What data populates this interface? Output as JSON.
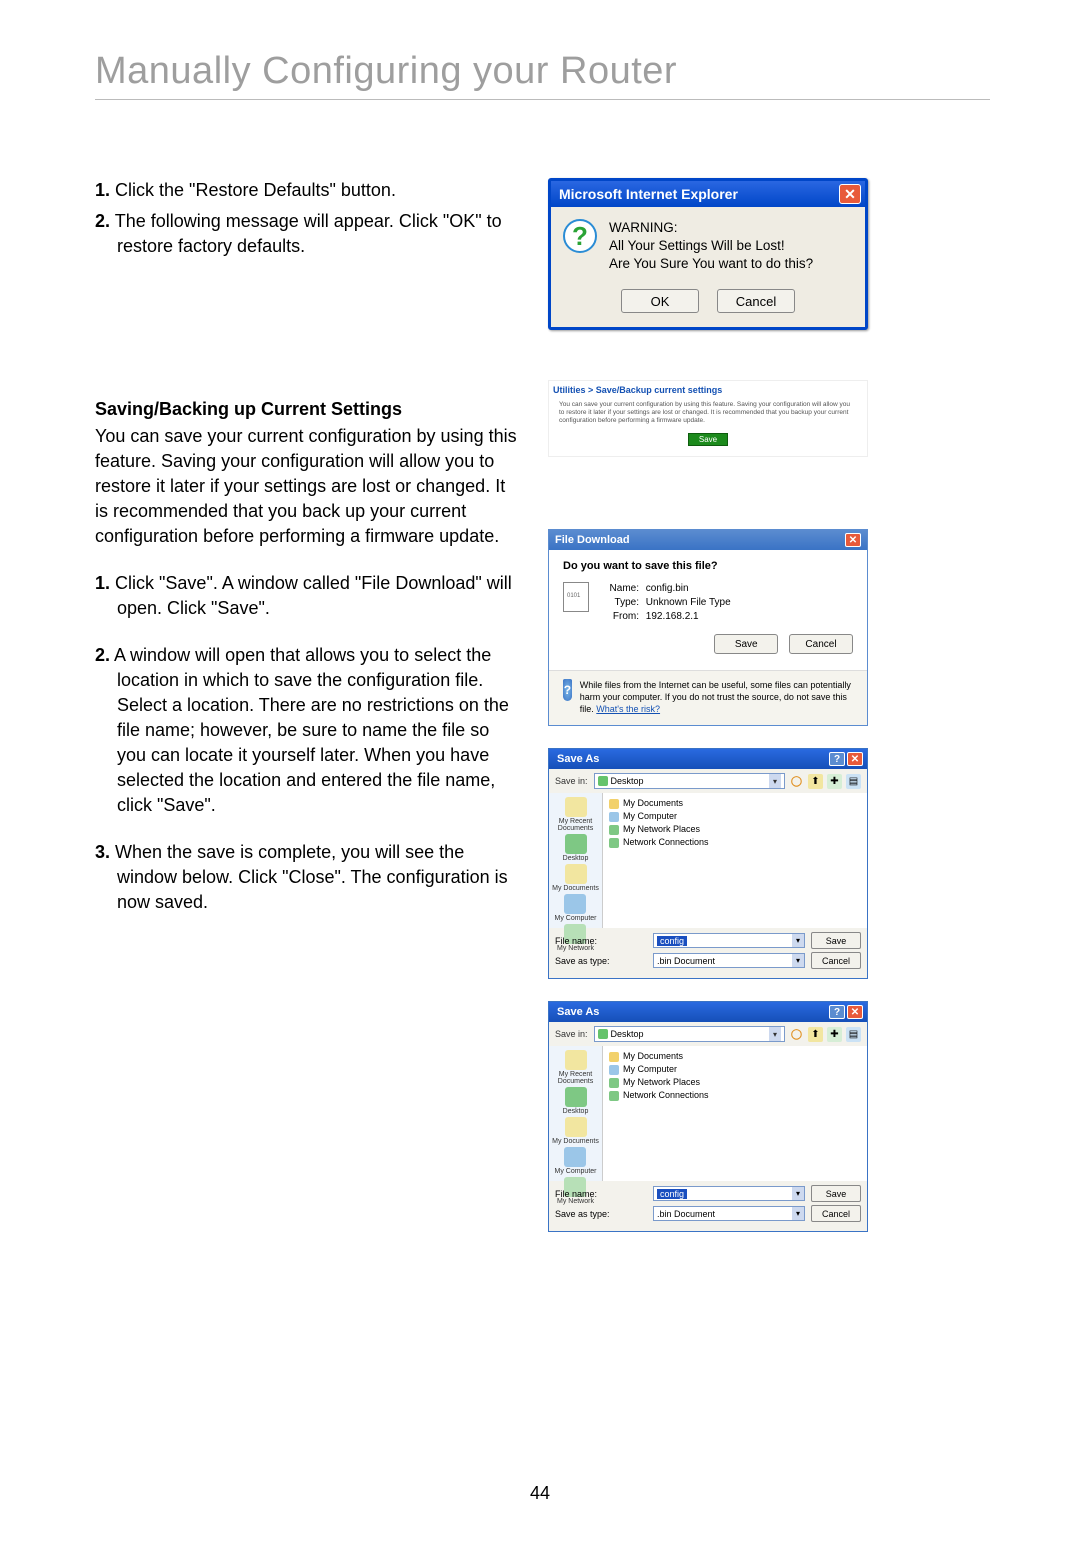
{
  "page_title": "Manually Configuring your Router",
  "page_number": "44",
  "steps_top": [
    {
      "n": "1.",
      "text": "Click the \"Restore Defaults\" button."
    },
    {
      "n": "2.",
      "text": "The following message will appear. Click \"OK\" to restore factory defaults."
    }
  ],
  "subhead": "Saving/Backing up Current Settings",
  "para_save": "You can save your current configuration by using this feature. Saving your configuration will allow you to restore it later if your settings are lost or changed. It is recommended that you back up your current configuration before performing a firmware update.",
  "steps_save": [
    {
      "n": "1.",
      "text": "Click \"Save\". A window called \"File Download\" will open. Click \"Save\"."
    },
    {
      "n": "2.",
      "text": "A window will open that allows you to select the location in which to save the configuration file. Select a location. There are no restrictions on the file name; however, be sure to name the file so you can locate it yourself later. When you have selected the location and entered the file name, click \"Save\"."
    },
    {
      "n": "3.",
      "text": "When the save is complete, you will see the window below. Click \"Close\". The configuration is now saved."
    }
  ],
  "ie_dialog": {
    "title": "Microsoft Internet Explorer",
    "warning_label": "WARNING:",
    "line1": "All Your Settings Will be Lost!",
    "line2": "Are You Sure You want to do this?",
    "ok": "OK",
    "cancel": "Cancel"
  },
  "router_panel": {
    "breadcrumb": "Utilities > Save/Backup current settings",
    "desc": "You can save your current configuration by using this feature. Saving your configuration will allow you to restore it later if your settings are lost or changed. It is recommended that you backup your current configuration before performing a firmware update.",
    "save": "Save"
  },
  "file_download": {
    "title": "File Download",
    "question": "Do you want to save this file?",
    "name_label": "Name:",
    "name": "config.bin",
    "type_label": "Type:",
    "type": "Unknown File Type",
    "from_label": "From:",
    "from": "192.168.2.1",
    "save": "Save",
    "cancel": "Cancel",
    "warn": "While files from the Internet can be useful, some files can potentially harm your computer. If you do not trust the source, do not save this file.",
    "risk": "What's the risk?"
  },
  "save_as": {
    "title": "Save As",
    "savein_label": "Save in:",
    "savein_value": "Desktop",
    "listing": [
      "My Documents",
      "My Computer",
      "My Network Places",
      "Network Connections"
    ],
    "places": {
      "recent": "My Recent Documents",
      "desktop": "Desktop",
      "documents": "My Documents",
      "computer": "My Computer",
      "network": "My Network"
    },
    "filename_label": "File name:",
    "filename_value": "config",
    "saveastype_label": "Save as type:",
    "saveastype_value": ".bin Document",
    "save": "Save",
    "cancel": "Cancel"
  }
}
